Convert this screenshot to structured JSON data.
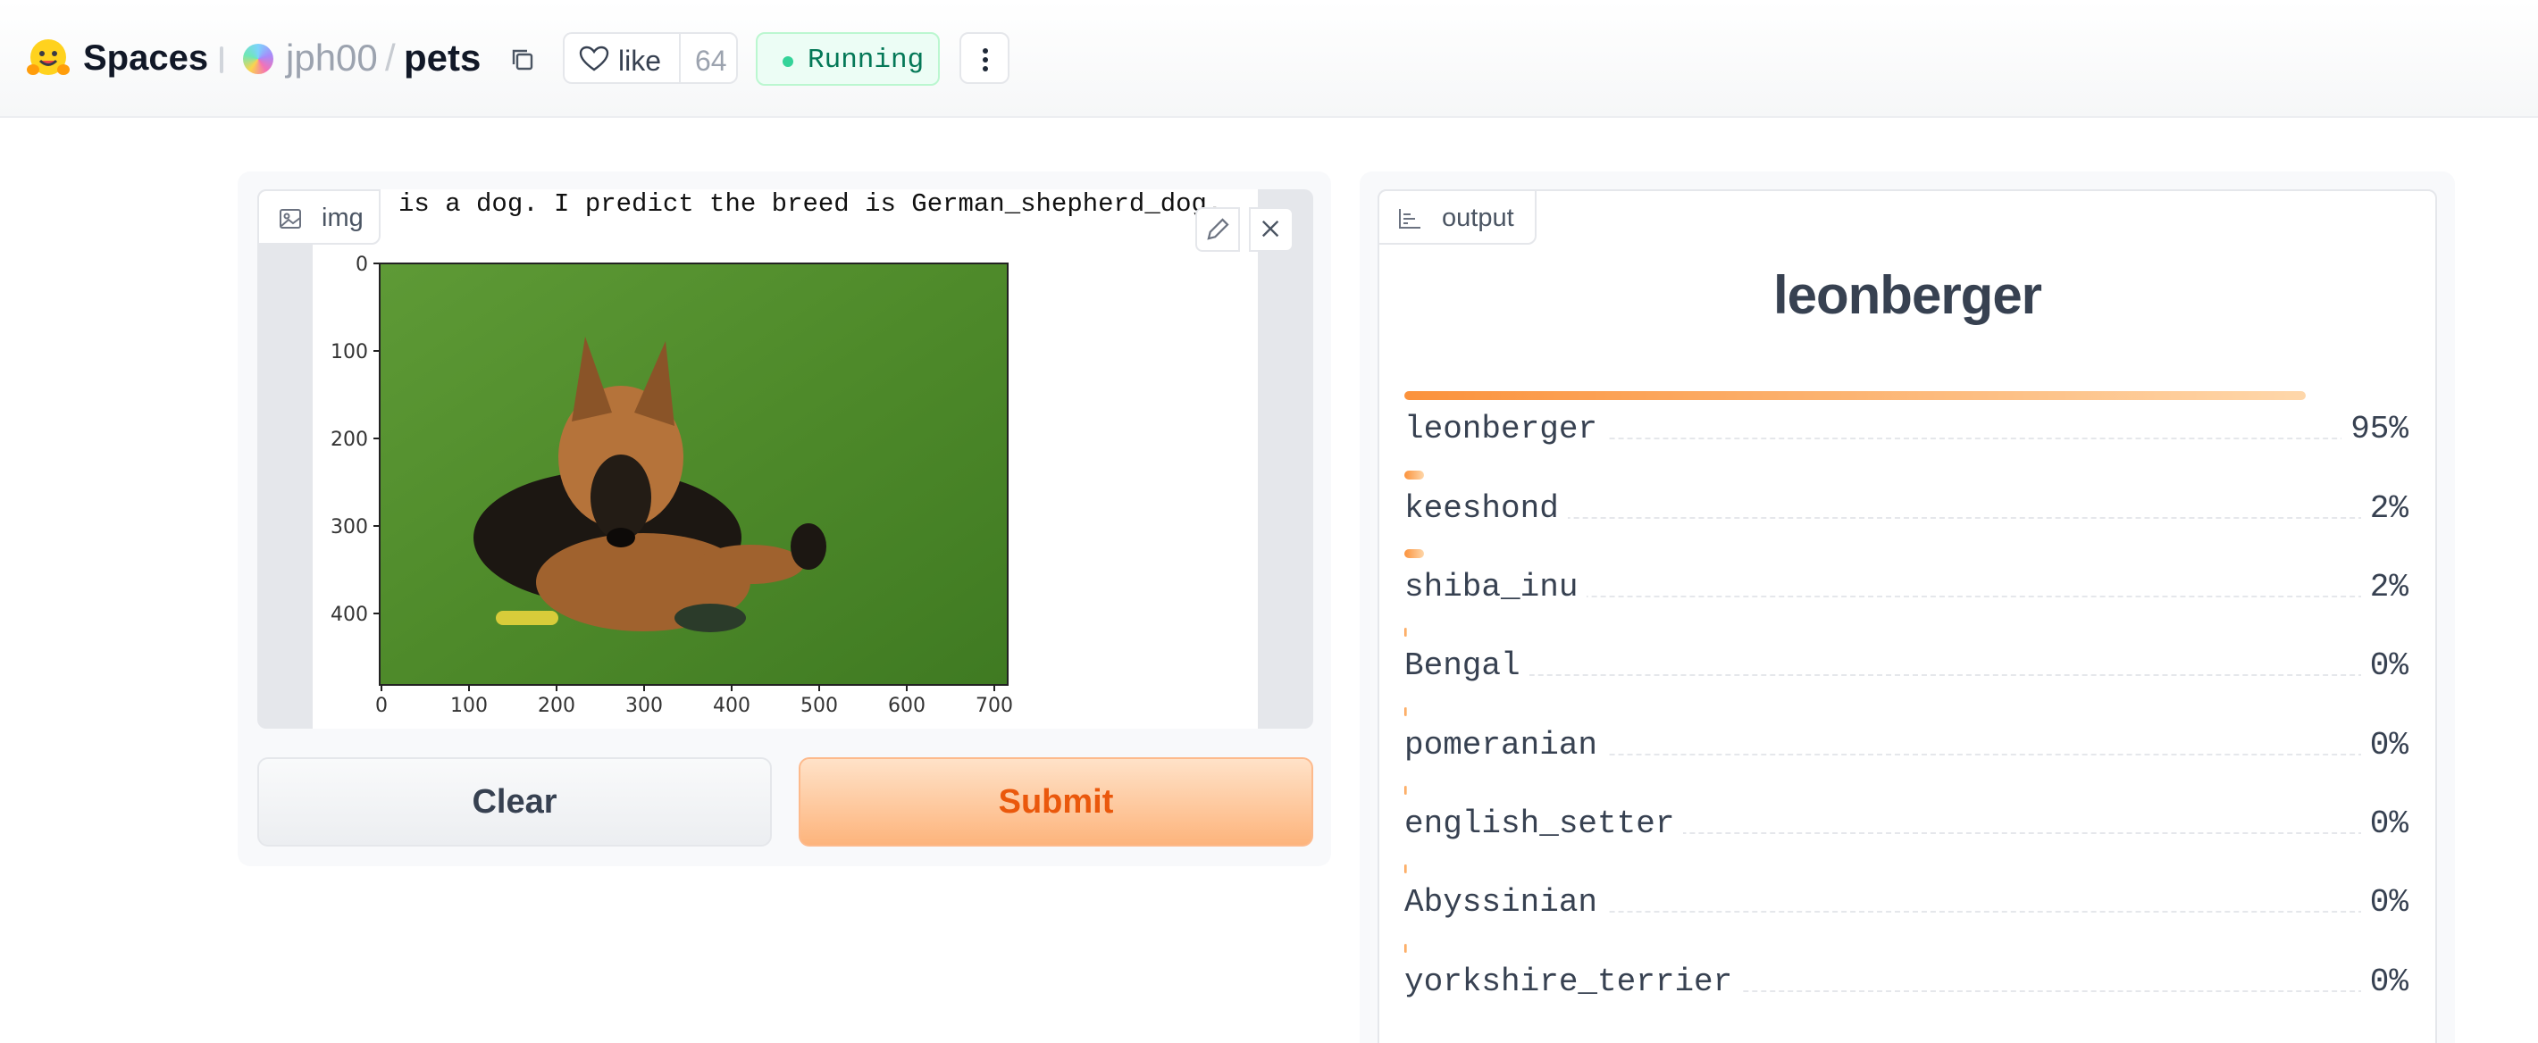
{
  "header": {
    "brand": "Spaces",
    "owner": "jph00",
    "separator": "/",
    "repo": "pets",
    "like_label": "like",
    "like_count": "64",
    "status": "Running"
  },
  "input": {
    "label": "img",
    "image_caption": "is a dog. I predict the breed is German_shepherd_dog.",
    "y_ticks": [
      "0",
      "100",
      "200",
      "300",
      "400"
    ],
    "x_ticks": [
      "0",
      "100",
      "200",
      "300",
      "400",
      "500",
      "600",
      "700"
    ]
  },
  "buttons": {
    "clear": "Clear",
    "submit": "Submit"
  },
  "output": {
    "label": "output",
    "top_label": "leonberger",
    "confidences": [
      {
        "name": "leonberger",
        "pct": "95%",
        "value": 0.95
      },
      {
        "name": "keeshond",
        "pct": "2%",
        "value": 0.02
      },
      {
        "name": "shiba_inu",
        "pct": "2%",
        "value": 0.02
      },
      {
        "name": "Bengal",
        "pct": "0%",
        "value": 0.0
      },
      {
        "name": "pomeranian",
        "pct": "0%",
        "value": 0.0
      },
      {
        "name": "english_setter",
        "pct": "0%",
        "value": 0.0
      },
      {
        "name": "Abyssinian",
        "pct": "0%",
        "value": 0.0
      },
      {
        "name": "yorkshire_terrier",
        "pct": "0%",
        "value": 0.0
      }
    ]
  },
  "colors": {
    "accent_orange": "#f97316",
    "status_green": "#047857",
    "grass_green": "#4f8a2b"
  },
  "icons": [
    "hugging-face-logo",
    "copy-icon",
    "heart-icon",
    "more-vertical-icon",
    "image-icon",
    "pencil-icon",
    "close-icon",
    "chart-icon"
  ]
}
